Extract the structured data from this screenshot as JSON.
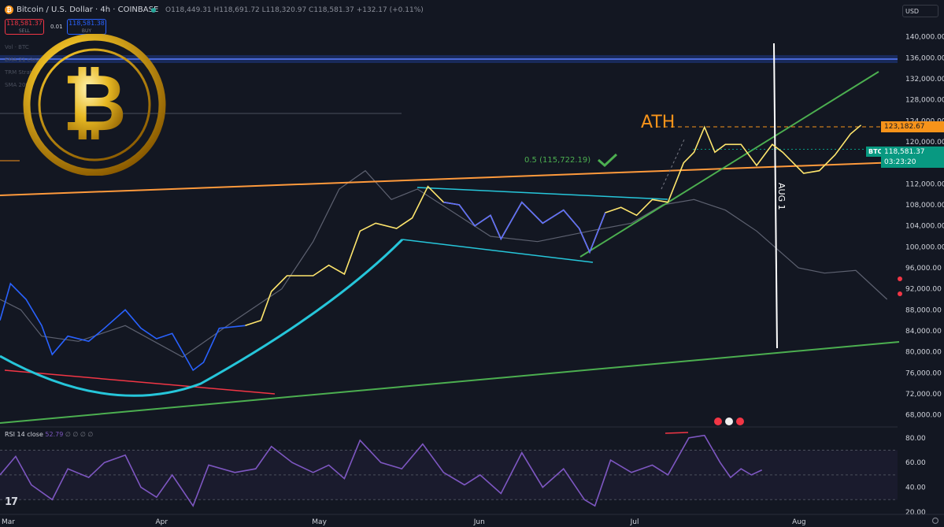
{
  "header": {
    "symbol": "Bitcoin / U.S. Dollar · 4h · COINBASE",
    "symbol_icon": "bitcoin-icon",
    "ohlc": "O118,449.31 H118,691.72 L118,320.97 C118,581.37 +132.17 (+0.11%)",
    "currency": "USD"
  },
  "trade": {
    "sell_price": "118,581.37",
    "sell_label": "SELL",
    "spread": "0.01",
    "buy_price": "118,581.38",
    "buy_label": "BUY"
  },
  "indicators": [
    "Vol · BTC",
    "EMA 21 close",
    "TRM Strat",
    "SMA 200"
  ],
  "chart_data": {
    "type": "line",
    "title": "Bitcoin / U.S. Dollar · 4h · COINBASE",
    "y_scale": "linear",
    "ylim": [
      66000,
      142500
    ],
    "xlim": [
      "2025-03-01",
      "2025-08-20"
    ],
    "grid": false,
    "price_ticks": [
      140000,
      136000,
      132000,
      128000,
      124000,
      120000,
      116000,
      112000,
      108000,
      104000,
      100000,
      96000,
      92000,
      88000,
      84000,
      80000,
      76000,
      72000,
      68000
    ],
    "price_tick_labels": [
      "140,000.00",
      "136,000.00",
      "132,000.00",
      "128,000.00",
      "124,000.00",
      "120,000.00",
      "116,000.00",
      "112,000.00",
      "108,000.00",
      "104,000.00",
      "100,000.00",
      "96,000.00",
      "92,000.00",
      "88,000.00",
      "84,000.00",
      "80,000.00",
      "76,000.00",
      "72,000.00",
      "68,000.00"
    ],
    "x_ticks": [
      {
        "label": "Mar",
        "date": "2025-03-01"
      },
      {
        "label": "Apr",
        "date": "2025-04-01"
      },
      {
        "label": "May",
        "date": "2025-05-01"
      },
      {
        "label": "Jun",
        "date": "2025-06-01"
      },
      {
        "label": "Jul",
        "date": "2025-07-01"
      },
      {
        "label": "Aug",
        "date": "2025-08-01"
      }
    ],
    "price_series": [
      [
        "2025-03-01",
        86000
      ],
      [
        "2025-03-03",
        93000
      ],
      [
        "2025-03-06",
        90000
      ],
      [
        "2025-03-09",
        85000
      ],
      [
        "2025-03-11",
        79500
      ],
      [
        "2025-03-14",
        83000
      ],
      [
        "2025-03-18",
        82000
      ],
      [
        "2025-03-21",
        84500
      ],
      [
        "2025-03-25",
        88000
      ],
      [
        "2025-03-28",
        84500
      ],
      [
        "2025-03-31",
        82500
      ],
      [
        "2025-04-03",
        83500
      ],
      [
        "2025-04-07",
        76500
      ],
      [
        "2025-04-09",
        78000
      ],
      [
        "2025-04-12",
        84500
      ],
      [
        "2025-04-17",
        85000
      ],
      [
        "2025-04-20",
        86000
      ],
      [
        "2025-04-22",
        91500
      ],
      [
        "2025-04-25",
        94500
      ],
      [
        "2025-04-30",
        94500
      ],
      [
        "2025-05-03",
        96500
      ],
      [
        "2025-05-06",
        94800
      ],
      [
        "2025-05-09",
        103000
      ],
      [
        "2025-05-12",
        104500
      ],
      [
        "2025-05-16",
        103500
      ],
      [
        "2025-05-19",
        105500
      ],
      [
        "2025-05-22",
        111500
      ],
      [
        "2025-05-25",
        108500
      ],
      [
        "2025-05-28",
        108000
      ],
      [
        "2025-05-31",
        104000
      ],
      [
        "2025-06-03",
        106000
      ],
      [
        "2025-06-05",
        101500
      ],
      [
        "2025-06-09",
        108500
      ],
      [
        "2025-06-13",
        104500
      ],
      [
        "2025-06-17",
        107000
      ],
      [
        "2025-06-20",
        103500
      ],
      [
        "2025-06-22",
        99000
      ],
      [
        "2025-06-25",
        106500
      ],
      [
        "2025-06-28",
        107500
      ],
      [
        "2025-07-01",
        106000
      ],
      [
        "2025-07-04",
        109000
      ],
      [
        "2025-07-07",
        108500
      ],
      [
        "2025-07-10",
        116000
      ],
      [
        "2025-07-12",
        118000
      ],
      [
        "2025-07-14",
        122800
      ],
      [
        "2025-07-16",
        118000
      ],
      [
        "2025-07-18",
        119500
      ],
      [
        "2025-07-21",
        119500
      ],
      [
        "2025-07-24",
        115500
      ],
      [
        "2025-07-27",
        119500
      ],
      [
        "2025-07-29",
        118000
      ],
      [
        "2025-07-31",
        116000
      ],
      [
        "2025-08-02",
        114000
      ],
      [
        "2025-08-05",
        114500
      ],
      [
        "2025-08-08",
        117500
      ],
      [
        "2025-08-11",
        121500
      ],
      [
        "2025-08-13",
        123182.67
      ]
    ],
    "ghost_series": [
      [
        "2025-03-01",
        90000
      ],
      [
        "2025-03-05",
        88000
      ],
      [
        "2025-03-09",
        83000
      ],
      [
        "2025-03-16",
        82000
      ],
      [
        "2025-03-25",
        85000
      ],
      [
        "2025-04-05",
        79000
      ],
      [
        "2025-04-15",
        86000
      ],
      [
        "2025-04-24",
        92000
      ],
      [
        "2025-04-30",
        101000
      ],
      [
        "2025-05-05",
        111000
      ],
      [
        "2025-05-10",
        114500
      ],
      [
        "2025-05-15",
        109000
      ],
      [
        "2025-05-20",
        111000
      ],
      [
        "2025-05-27",
        106500
      ],
      [
        "2025-06-03",
        102000
      ],
      [
        "2025-06-12",
        101000
      ],
      [
        "2025-06-22",
        103000
      ],
      [
        "2025-06-30",
        104500
      ],
      [
        "2025-07-06",
        108000
      ],
      [
        "2025-07-12",
        109000
      ],
      [
        "2025-07-18",
        107000
      ],
      [
        "2025-07-24",
        103000
      ],
      [
        "2025-08-01",
        96000
      ],
      [
        "2025-08-06",
        95000
      ],
      [
        "2025-08-12",
        95500
      ],
      [
        "2025-08-18",
        90000
      ]
    ],
    "levels": [
      {
        "price": 123182.67,
        "label": "123,182.67",
        "color": "#f7931a",
        "style": "dashed"
      },
      {
        "price": 118581.37,
        "label": "118,581.37",
        "color": "#089981",
        "style": "dotted",
        "symbol_tag": "BTCUSD",
        "countdown": "03:23:20"
      }
    ],
    "resistance_zone": [
      135000,
      136500
    ],
    "annotations": [
      {
        "text": "ATH",
        "color": "#f7931a"
      },
      {
        "text": "0.5 (115,722.19)",
        "color": "#4caf50"
      },
      {
        "text": "AUG 1",
        "color": "#ffffff"
      }
    ],
    "rsi": {
      "label": "RSI 14 close",
      "value": "52.79",
      "extra": "∅ ∅ ∅ ∅",
      "ylim": [
        20,
        85
      ],
      "ticks": [
        80,
        60,
        40,
        20
      ],
      "tick_labels": [
        "80.00",
        "60.00",
        "40.00",
        "20.00"
      ],
      "band": [
        30,
        70
      ],
      "series": [
        [
          "2025-03-01",
          50
        ],
        [
          "2025-03-04",
          65
        ],
        [
          "2025-03-07",
          42
        ],
        [
          "2025-03-11",
          30
        ],
        [
          "2025-03-14",
          55
        ],
        [
          "2025-03-18",
          48
        ],
        [
          "2025-03-21",
          60
        ],
        [
          "2025-03-25",
          66
        ],
        [
          "2025-03-28",
          40
        ],
        [
          "2025-03-31",
          32
        ],
        [
          "2025-04-03",
          50
        ],
        [
          "2025-04-07",
          25
        ],
        [
          "2025-04-10",
          58
        ],
        [
          "2025-04-15",
          52
        ],
        [
          "2025-04-19",
          55
        ],
        [
          "2025-04-22",
          73
        ],
        [
          "2025-04-26",
          60
        ],
        [
          "2025-04-30",
          52
        ],
        [
          "2025-05-03",
          58
        ],
        [
          "2025-05-06",
          47
        ],
        [
          "2025-05-09",
          78
        ],
        [
          "2025-05-13",
          60
        ],
        [
          "2025-05-17",
          55
        ],
        [
          "2025-05-21",
          75
        ],
        [
          "2025-05-25",
          52
        ],
        [
          "2025-05-29",
          42
        ],
        [
          "2025-06-01",
          50
        ],
        [
          "2025-06-05",
          35
        ],
        [
          "2025-06-09",
          68
        ],
        [
          "2025-06-13",
          40
        ],
        [
          "2025-06-17",
          55
        ],
        [
          "2025-06-21",
          30
        ],
        [
          "2025-06-23",
          25
        ],
        [
          "2025-06-26",
          62
        ],
        [
          "2025-06-30",
          52
        ],
        [
          "2025-07-04",
          58
        ],
        [
          "2025-07-07",
          50
        ],
        [
          "2025-07-11",
          80
        ],
        [
          "2025-07-14",
          82
        ],
        [
          "2025-07-17",
          60
        ],
        [
          "2025-07-19",
          48
        ],
        [
          "2025-07-21",
          55
        ],
        [
          "2025-07-23",
          50
        ],
        [
          "2025-07-25",
          54
        ]
      ]
    }
  }
}
